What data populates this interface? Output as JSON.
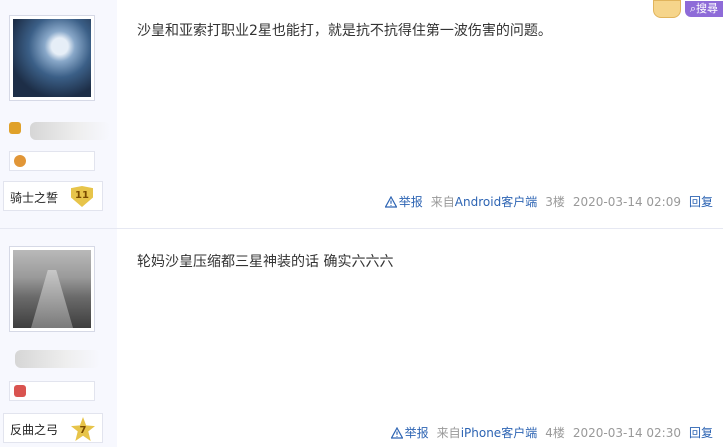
{
  "top_bar": {
    "search_label": "搜尋"
  },
  "posts": [
    {
      "level": {
        "name": "骑士之誓",
        "number": "11"
      },
      "content": "沙皇和亚索打职业2星也能打，就是抗不抗得住第一波伤害的问题。",
      "report_label": "举报",
      "from_prefix": "来自",
      "client": "Android客户端",
      "floor": "3楼",
      "time": "2020-03-14 02:09",
      "reply_label": "回复"
    },
    {
      "level": {
        "name": "反曲之弓",
        "number": "7"
      },
      "content": "轮妈沙皇压缩都三星神装的话 确实六六六",
      "report_label": "举报",
      "from_prefix": "来自",
      "client": "iPhone客户端",
      "floor": "4楼",
      "time": "2020-03-14 02:30",
      "reply_label": "回复"
    }
  ],
  "colors": {
    "link": "#2d64b3",
    "meta": "#999999",
    "sidebar_bg": "#f7f8fe"
  }
}
